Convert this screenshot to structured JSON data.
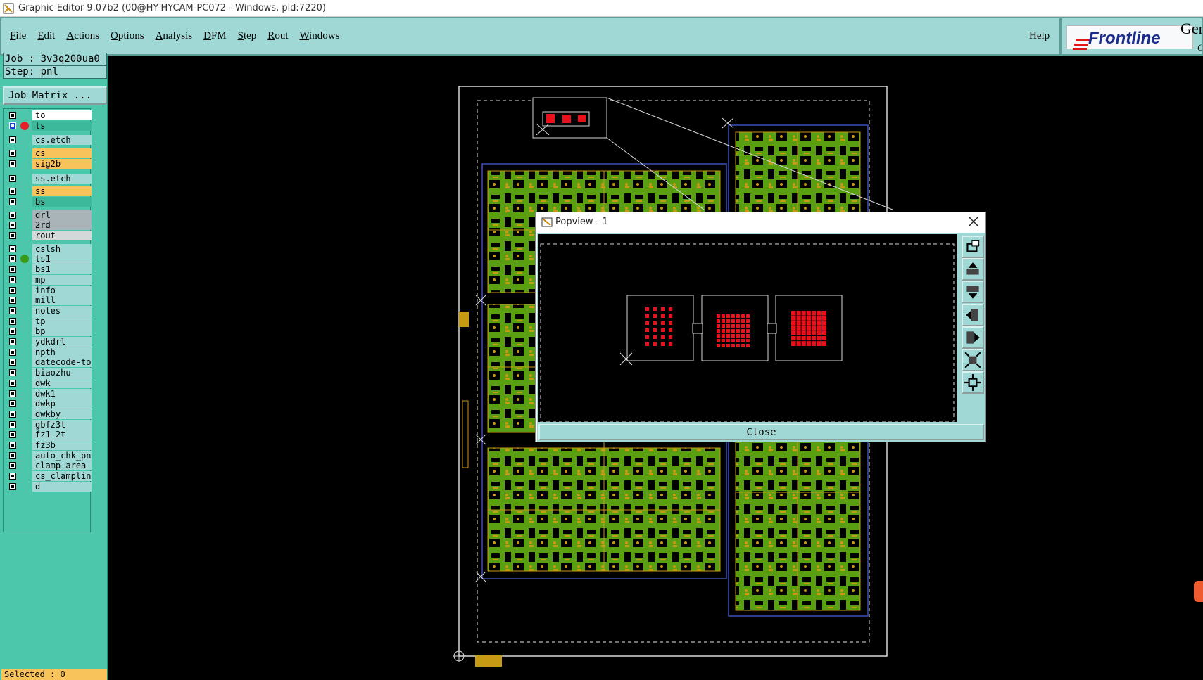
{
  "window": {
    "title": "Graphic Editor 9.07b2 (00@HY-HYCAM-PC072 - Windows, pid:7220)"
  },
  "menu": {
    "items": [
      "File",
      "Edit",
      "Actions",
      "Options",
      "Analysis",
      "DFM",
      "Step",
      "Rout",
      "Windows"
    ],
    "help": "Help"
  },
  "brand": {
    "logo": "Frontline",
    "product_fragment": "Gen",
    "sub_fragment": "G"
  },
  "job": {
    "job_label": "Job : 3v3q200ua0",
    "step_label": "Step: pnl",
    "matrix_button": "Job Matrix ..."
  },
  "layers": [
    {
      "name": "to",
      "color": "#ffffff"
    },
    {
      "name": "ts",
      "color": "#3cb89a",
      "selected": true,
      "dot": "#e8202a"
    },
    {
      "name": "cs.etch",
      "color": "#9fd8d4"
    },
    {
      "name": "cs",
      "color": "#f7c35a"
    },
    {
      "name": "sig2b",
      "color": "#f7c35a"
    },
    {
      "name": "ss.etch",
      "color": "#9fd8d4"
    },
    {
      "name": "ss",
      "color": "#f7c35a"
    },
    {
      "name": "bs",
      "color": "#3cb89a"
    },
    {
      "name": "drl",
      "color": "#a8b4b8"
    },
    {
      "name": "2rd",
      "color": "#a8b4b8"
    },
    {
      "name": "rout",
      "color": "#d4d8d8"
    },
    {
      "name": "cslsh",
      "color": "#9fd8d4"
    },
    {
      "name": "ts1",
      "color": "#9fd8d4",
      "dot": "#3a9a1a"
    },
    {
      "name": "bs1",
      "color": "#9fd8d4"
    },
    {
      "name": "mp",
      "color": "#9fd8d4"
    },
    {
      "name": "info",
      "color": "#9fd8d4"
    },
    {
      "name": "mill",
      "color": "#9fd8d4"
    },
    {
      "name": "notes",
      "color": "#9fd8d4"
    },
    {
      "name": "tp",
      "color": "#9fd8d4"
    },
    {
      "name": "bp",
      "color": "#9fd8d4"
    },
    {
      "name": "ydkdrl",
      "color": "#9fd8d4"
    },
    {
      "name": "npth",
      "color": "#9fd8d4"
    },
    {
      "name": "datecode-to",
      "color": "#9fd8d4"
    },
    {
      "name": "biaozhu",
      "color": "#9fd8d4"
    },
    {
      "name": "dwk",
      "color": "#9fd8d4"
    },
    {
      "name": "dwk1",
      "color": "#9fd8d4"
    },
    {
      "name": "dwkp",
      "color": "#9fd8d4"
    },
    {
      "name": "dwkby",
      "color": "#9fd8d4"
    },
    {
      "name": "gbfz3t",
      "color": "#9fd8d4"
    },
    {
      "name": "fz1-2t",
      "color": "#9fd8d4"
    },
    {
      "name": "fz3b",
      "color": "#9fd8d4"
    },
    {
      "name": "auto_chk_pnl",
      "color": "#9fd8d4"
    },
    {
      "name": "clamp_area",
      "color": "#9fd8d4"
    },
    {
      "name": "cs_clampline",
      "color": "#9fd8d4"
    },
    {
      "name": "d",
      "color": "#9fd8d4"
    }
  ],
  "status": {
    "selected": "Selected : 0"
  },
  "popview": {
    "title": "Popview - 1",
    "close_label": "Close",
    "tools": [
      "zoom-window-icon",
      "pan-up-icon",
      "pan-down-icon",
      "pan-left-icon",
      "pan-right-icon",
      "zoom-fit-icon",
      "zoom-home-icon"
    ]
  },
  "colors": {
    "accent": "#9fd8d4",
    "panel": "#4dc7ab",
    "pad": "#e8101a",
    "board_green": "#6cc21e",
    "copper": "#c79a14",
    "outline": "#3a4fb8"
  }
}
